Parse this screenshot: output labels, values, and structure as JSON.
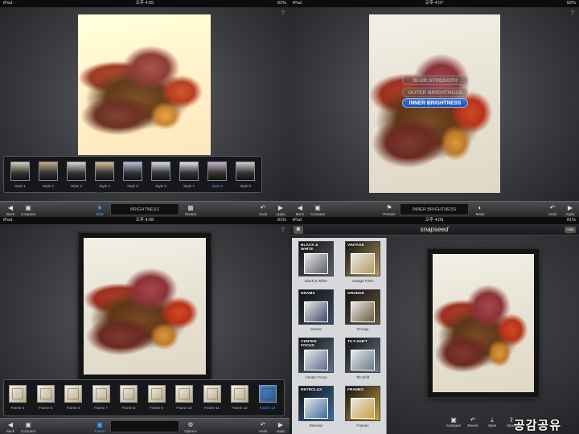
{
  "q1": {
    "status": {
      "device": "iPad",
      "wifi": "≈",
      "time": "오후 4:05",
      "battery": "82%"
    },
    "help": "?",
    "styles": [
      {
        "label": "Style 1",
        "color": "#cfd3b8"
      },
      {
        "label": "Style 2",
        "color": "#c6a886"
      },
      {
        "label": "Style 3",
        "color": "#dbd9cf"
      },
      {
        "label": "Style 4",
        "color": "#d4c090"
      },
      {
        "label": "Style 5",
        "color": "#b9c0d8"
      },
      {
        "label": "Style 6",
        "color": "#d8e0ea"
      },
      {
        "label": "Style 7",
        "color": "#dfe4e8"
      },
      {
        "label": "Style 8",
        "color": "#c8b4c8"
      },
      {
        "label": "Style 9",
        "color": "#c8d0cc"
      }
    ],
    "active_style": "Style 8",
    "toolbar": {
      "back": "Back",
      "compare": "Compare",
      "style": "Style",
      "brightness": "BRIGHTNESS",
      "texture": "Texture",
      "undo": "Undo",
      "apply": "Apply"
    }
  },
  "q2": {
    "status": {
      "device": "iPad",
      "wifi": "≈",
      "time": "오후 4:07",
      "battery": "82%"
    },
    "help": "?",
    "menu": [
      "BLUR STRENGTH",
      "OUTER BRIGHTNESS",
      "INNER BRIGHTNESS"
    ],
    "toolbar": {
      "back": "Back",
      "compare": "Compare",
      "presets": "Presets",
      "inner": "INNER BRIGHTNESS",
      "mask": "Mask",
      "undo": "Undo",
      "apply": "Apply"
    }
  },
  "q3": {
    "status": {
      "device": "iPad",
      "wifi": "≈",
      "time": "오후 4:08",
      "battery": "81%"
    },
    "help": "?",
    "frames": [
      "Frame 4",
      "Frame 5",
      "Frame 6",
      "Frame 7",
      "Frame 8",
      "Frame 9",
      "Frame 10",
      "Frame 11",
      "Frame 12",
      "Frame 13"
    ],
    "active_frame": "Frame 13",
    "toolbar": {
      "back": "Back",
      "compare": "Compare",
      "frame": "Frame",
      "options": "Options",
      "undo": "Undo",
      "apply": "Apply"
    }
  },
  "q4": {
    "status": {
      "device": "iPad",
      "wifi": "≈",
      "time": "오후 4:09",
      "battery": "81%"
    },
    "title": "snapseed",
    "help": "Help",
    "filters": [
      {
        "title": "BLACK & WHITE",
        "caption": "Black & White",
        "color": "#5a5f66"
      },
      {
        "title": "VINTAGE",
        "caption": "Vintage Films",
        "color": "#b59a62"
      },
      {
        "title": "DRAMA",
        "caption": "Drama",
        "color": "#3c4a66"
      },
      {
        "title": "GRUNGE",
        "caption": "Grunge",
        "color": "#6b5a3a"
      },
      {
        "title": "CENTER FOCUS",
        "caption": "Center Focus",
        "color": "#5c6e8a"
      },
      {
        "title": "TILT-SHIFT",
        "caption": "Tilt-Shift",
        "color": "#6a7a8c"
      },
      {
        "title": "RETROLUX",
        "caption": "Retrolux",
        "color": "#3a6aa0"
      },
      {
        "title": "FRAMES",
        "caption": "Frames",
        "color": "#c8a040"
      }
    ],
    "tools": {
      "compare": "Compare",
      "revert": "Revert",
      "save": "Save",
      "share": "Share"
    },
    "watermark": "공감공유"
  }
}
